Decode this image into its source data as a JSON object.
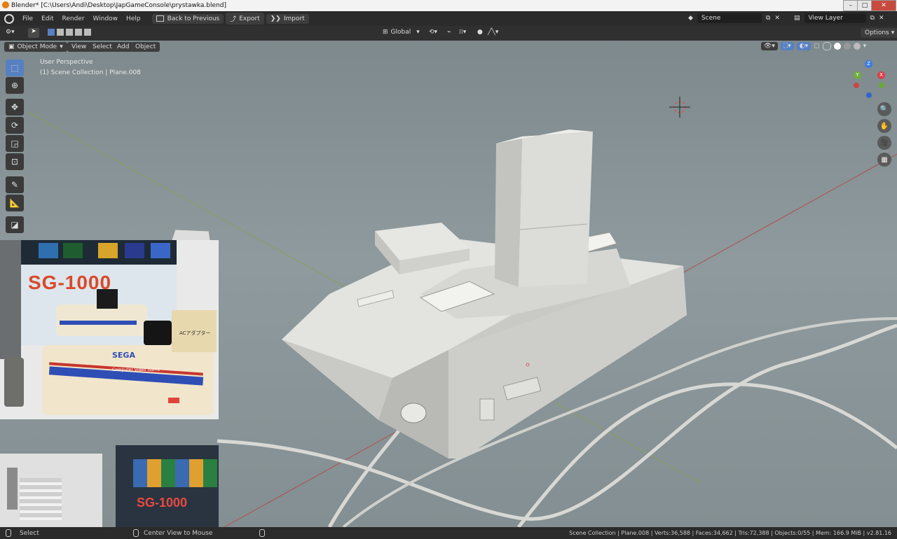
{
  "window": {
    "title": "Blender* [C:\\Users\\Andi\\Desktop\\JapGameConsole\\prystawka.blend]"
  },
  "menubar": {
    "items": [
      "File",
      "Edit",
      "Render",
      "Window",
      "Help"
    ],
    "back_to_previous": "Back to Previous",
    "export": "Export",
    "import": "Import",
    "scene": "Scene",
    "view_layer": "View Layer"
  },
  "tool_header": {
    "orientation": "Global",
    "options": "Options"
  },
  "viewport_header": {
    "mode": "Object Mode",
    "menus": [
      "View",
      "Select",
      "Add",
      "Object"
    ]
  },
  "viewport": {
    "perspective": "User Perspective",
    "collection": "(1) Scene Collection | Plane.008",
    "gizmo_axes": [
      "Z",
      "Y",
      "X"
    ]
  },
  "reference_image": {
    "sega_label": "SEGA",
    "model": "SG-1000",
    "subtitle": "Computer Video Game",
    "ac_label": "ACアダプター"
  },
  "statusbar": {
    "select": "Select",
    "center": "Center View to Mouse",
    "stats": "Scene Collection | Plane.008 | Verts:36,588 | Faces:34,662 | Tris:72,388 | Objects:0/55 | Mem: 166.9 MiB | v2.81.16"
  },
  "colors": {
    "accent": "#5680c2",
    "viewport": "#8a9699",
    "model": "#d9d9d4"
  }
}
